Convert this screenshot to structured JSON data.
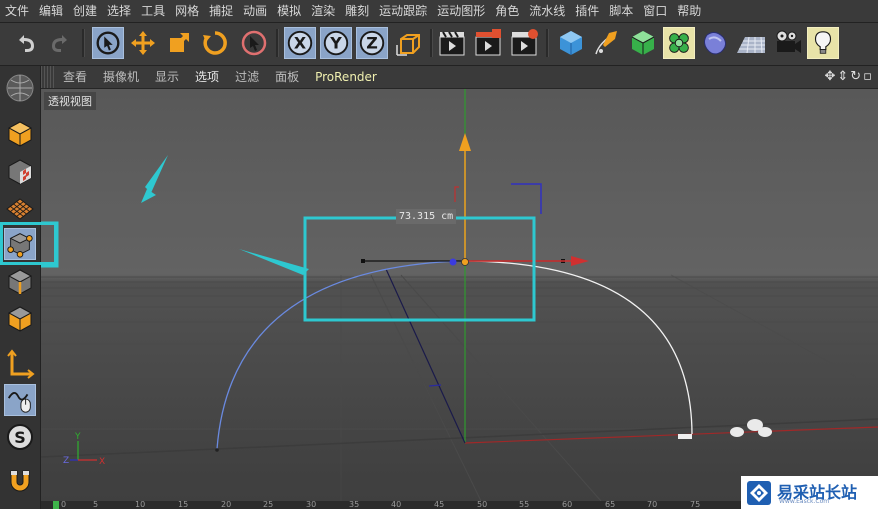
{
  "menubar": {
    "items": [
      "文件",
      "编辑",
      "创建",
      "选择",
      "工具",
      "网格",
      "捕捉",
      "动画",
      "模拟",
      "渲染",
      "雕刻",
      "运动跟踪",
      "运动图形",
      "角色",
      "流水线",
      "插件",
      "脚本",
      "窗口",
      "帮助"
    ]
  },
  "toolbar": {
    "buttons": [
      "undo-icon",
      "redo-icon",
      "live-selection-icon",
      "move-icon",
      "scale-icon",
      "rotate-icon",
      "last-tool-icon",
      "x-axis-lock-icon",
      "y-axis-lock-icon",
      "z-axis-lock-icon",
      "world-coordinates-icon",
      "render-view-icon",
      "render-picture-viewer-icon",
      "render-settings-icon",
      "cube-icon",
      "pen-spline-icon",
      "subdivision-icon",
      "mograph-cloner-icon",
      "deformer-icon",
      "floor-icon",
      "camera-icon",
      "light-icon"
    ],
    "axis_labels": {
      "x": "X",
      "y": "Y",
      "z": "Z"
    }
  },
  "leftbar": {
    "buttons": [
      "make-editable-icon",
      "model-mode-icon",
      "texture-mode-icon",
      "workplane-icon",
      "points-mode-icon",
      "edges-mode-icon",
      "polygons-mode-icon",
      "enable-axis-icon",
      "tweak-icon",
      "solo-icon",
      "snap-icon"
    ]
  },
  "viewport_menu": {
    "items": [
      "查看",
      "摄像机",
      "显示",
      "选项",
      "过滤",
      "面板",
      "ProRender"
    ],
    "active_index": 3
  },
  "viewport": {
    "label": "透视视图",
    "measure_text": "73.315 cm",
    "axis_gizmo": {
      "x": "X",
      "y": "Y",
      "z": "Z"
    }
  },
  "timeline": {
    "ticks": [
      "0",
      "5",
      "10",
      "15",
      "20",
      "25",
      "30",
      "35",
      "40",
      "45",
      "50",
      "55",
      "60",
      "65",
      "70",
      "75"
    ]
  },
  "watermark": {
    "name": "易采站长站",
    "url": "Www.Easck.Com"
  },
  "colors": {
    "selected": "#8aa4c8",
    "highlight": "#e8e3a8",
    "annotation_cyan": "#2ec8d0",
    "accent_orange": "#f0a020"
  }
}
